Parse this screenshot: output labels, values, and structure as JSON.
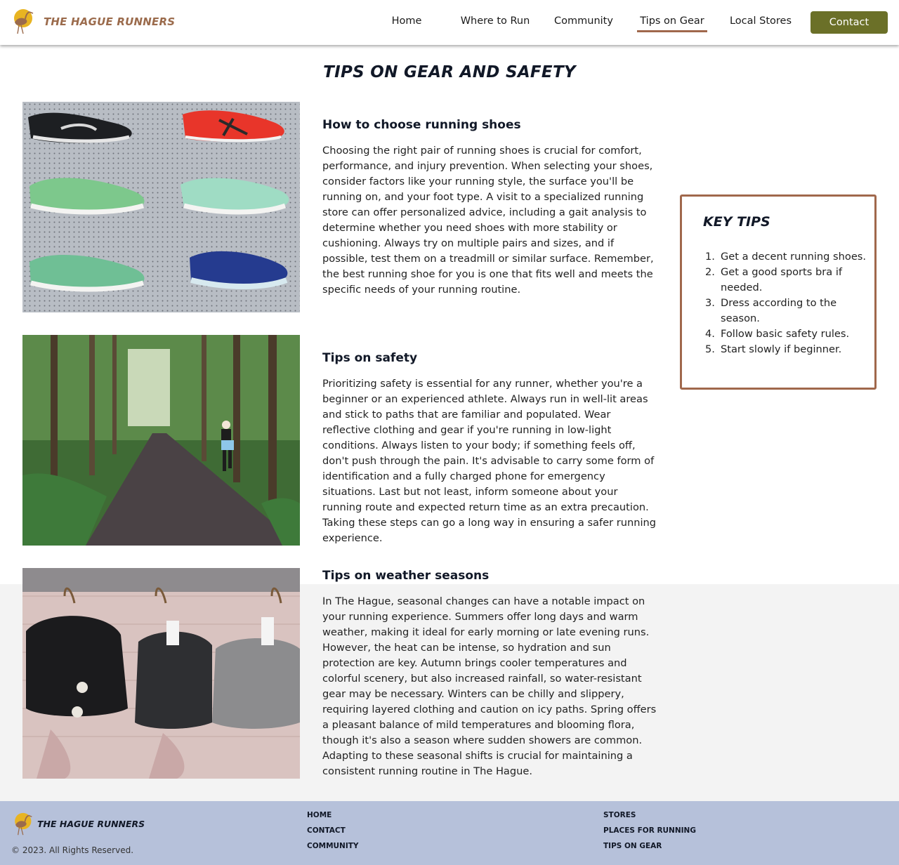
{
  "header": {
    "brand": "THE HAGUE RUNNERS",
    "logo_icon": "heron-sun-icon",
    "nav": [
      {
        "label": "Home"
      },
      {
        "label": "Where to Run"
      },
      {
        "label": "Community"
      },
      {
        "label": "Tips on Gear",
        "active": true
      },
      {
        "label": "Local Stores"
      }
    ],
    "contact_label": "Contact"
  },
  "main": {
    "title": "TIPS ON GEAR AND SAFETY",
    "sections": [
      {
        "title": "How to choose running shoes",
        "image": "running-shoes-wall-photo",
        "body": "Choosing the right pair of running shoes is crucial for comfort, performance, and injury prevention. When selecting your shoes, consider factors like your running style, the surface you'll be running on, and your foot type. A visit to a specialized running store can offer personalized advice, including a gait analysis to determine whether you need shoes with more stability or cushioning. Always try on multiple pairs and sizes, and if possible, test them on a treadmill or similar surface. Remember, the best running shoe for you is one that fits well and meets the specific needs of your running routine."
      },
      {
        "title": "Tips on safety",
        "image": "runner-forest-path-photo",
        "body": "Prioritizing safety is essential for any runner, whether you're a beginner or an experienced athlete. Always run in well-lit areas and stick to paths that are familiar and populated. Wear reflective clothing and gear if you're running in low-light conditions. Always listen to your body; if something feels off, don't push through the pain. It's advisable to carry some form of identification and a fully charged phone for emergency situations. Last but not least, inform someone about your running route and expected return time as an extra precaution. Taking these steps can go a long way in ensuring a safer running experience."
      },
      {
        "title": "Tips on weather seasons",
        "image": "running-beanies-photo",
        "body": "In The Hague, seasonal changes can have a notable impact on your running experience. Summers offer long days and warm weather, making it ideal for early morning or late evening runs. However, the heat can be intense, so hydration and sun protection are key. Autumn brings cooler temperatures and colorful scenery, but also increased rainfall, so water-resistant gear may be necessary. Winters can be chilly and slippery, requiring layered clothing and caution on icy paths. Spring offers a pleasant balance of mild temperatures and blooming flora, though it's also a season where sudden showers are common. Adapting to these seasonal shifts is crucial for maintaining a consistent running routine in The Hague."
      }
    ]
  },
  "key_tips": {
    "title": "KEY TIPS",
    "items": [
      {
        "num": "1.",
        "text": "Get a decent running shoes."
      },
      {
        "num": "2.",
        "text": "Get a good sports bra if needed."
      },
      {
        "num": "3.",
        "text": "Dress according to the season."
      },
      {
        "num": "4.",
        "text": "Follow basic safety rules."
      },
      {
        "num": "5.",
        "text": "Start slowly if beginner."
      }
    ]
  },
  "footer": {
    "brand": "THE HAGUE RUNNERS",
    "copyright": "© 2023. All Rights Reserved.",
    "col1": [
      {
        "label": "HOME"
      },
      {
        "label": "CONTACT"
      },
      {
        "label": "COMMUNITY"
      }
    ],
    "col2": [
      {
        "label": "STORES"
      },
      {
        "label": "PLACES FOR RUNNING"
      },
      {
        "label": "TIPS ON GEAR"
      }
    ]
  },
  "colors": {
    "brand": "#9b6b4c",
    "accent_button": "#6b7028",
    "active_underline": "#a0684c",
    "footer_bg": "#b6c1da",
    "band_bg": "#f3f3f3"
  }
}
